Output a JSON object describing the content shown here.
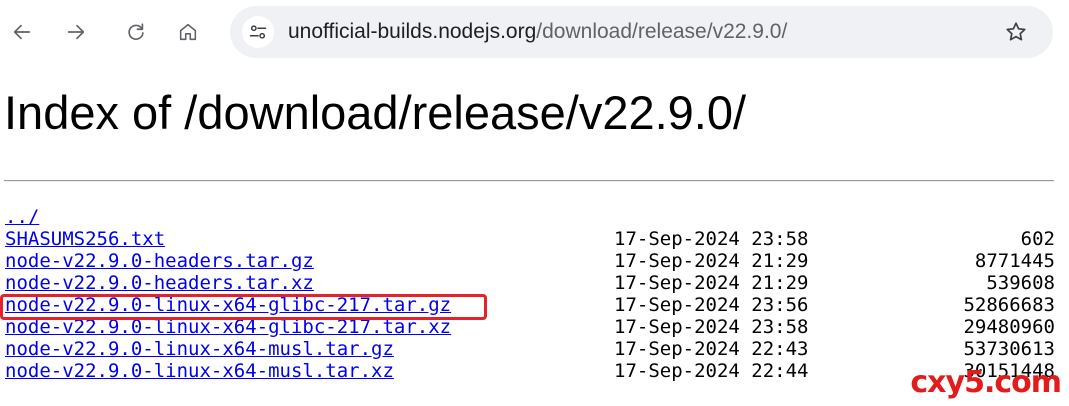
{
  "browser": {
    "url_host": "unofficial-builds.nodejs.org",
    "url_path": "/download/release/v22.9.0/"
  },
  "page": {
    "title": "Index of /download/release/v22.9.0/",
    "parent_link": "../",
    "files": [
      {
        "name": "SHASUMS256.txt",
        "date": "17-Sep-2024 23:58",
        "size": "602"
      },
      {
        "name": "node-v22.9.0-headers.tar.gz",
        "date": "17-Sep-2024 21:29",
        "size": "8771445"
      },
      {
        "name": "node-v22.9.0-headers.tar.xz",
        "date": "17-Sep-2024 21:29",
        "size": "539608"
      },
      {
        "name": "node-v22.9.0-linux-x64-glibc-217.tar.gz",
        "date": "17-Sep-2024 23:56",
        "size": "52866683"
      },
      {
        "name": "node-v22.9.0-linux-x64-glibc-217.tar.xz",
        "date": "17-Sep-2024 23:58",
        "size": "29480960"
      },
      {
        "name": "node-v22.9.0-linux-x64-musl.tar.gz",
        "date": "17-Sep-2024 22:43",
        "size": "53730613"
      },
      {
        "name": "node-v22.9.0-linux-x64-musl.tar.xz",
        "date": "17-Sep-2024 22:44",
        "size": "30151448"
      }
    ]
  },
  "watermark": "cxy5.com",
  "icons": {
    "back": "arrow-left-icon",
    "forward": "arrow-right-icon",
    "reload": "reload-icon",
    "home": "home-icon",
    "site_info": "tune-icon",
    "bookmark": "star-icon"
  },
  "colors": {
    "link": "#0000ee",
    "highlight": "#e4222b",
    "omnibox_bg": "#eff1f5"
  }
}
